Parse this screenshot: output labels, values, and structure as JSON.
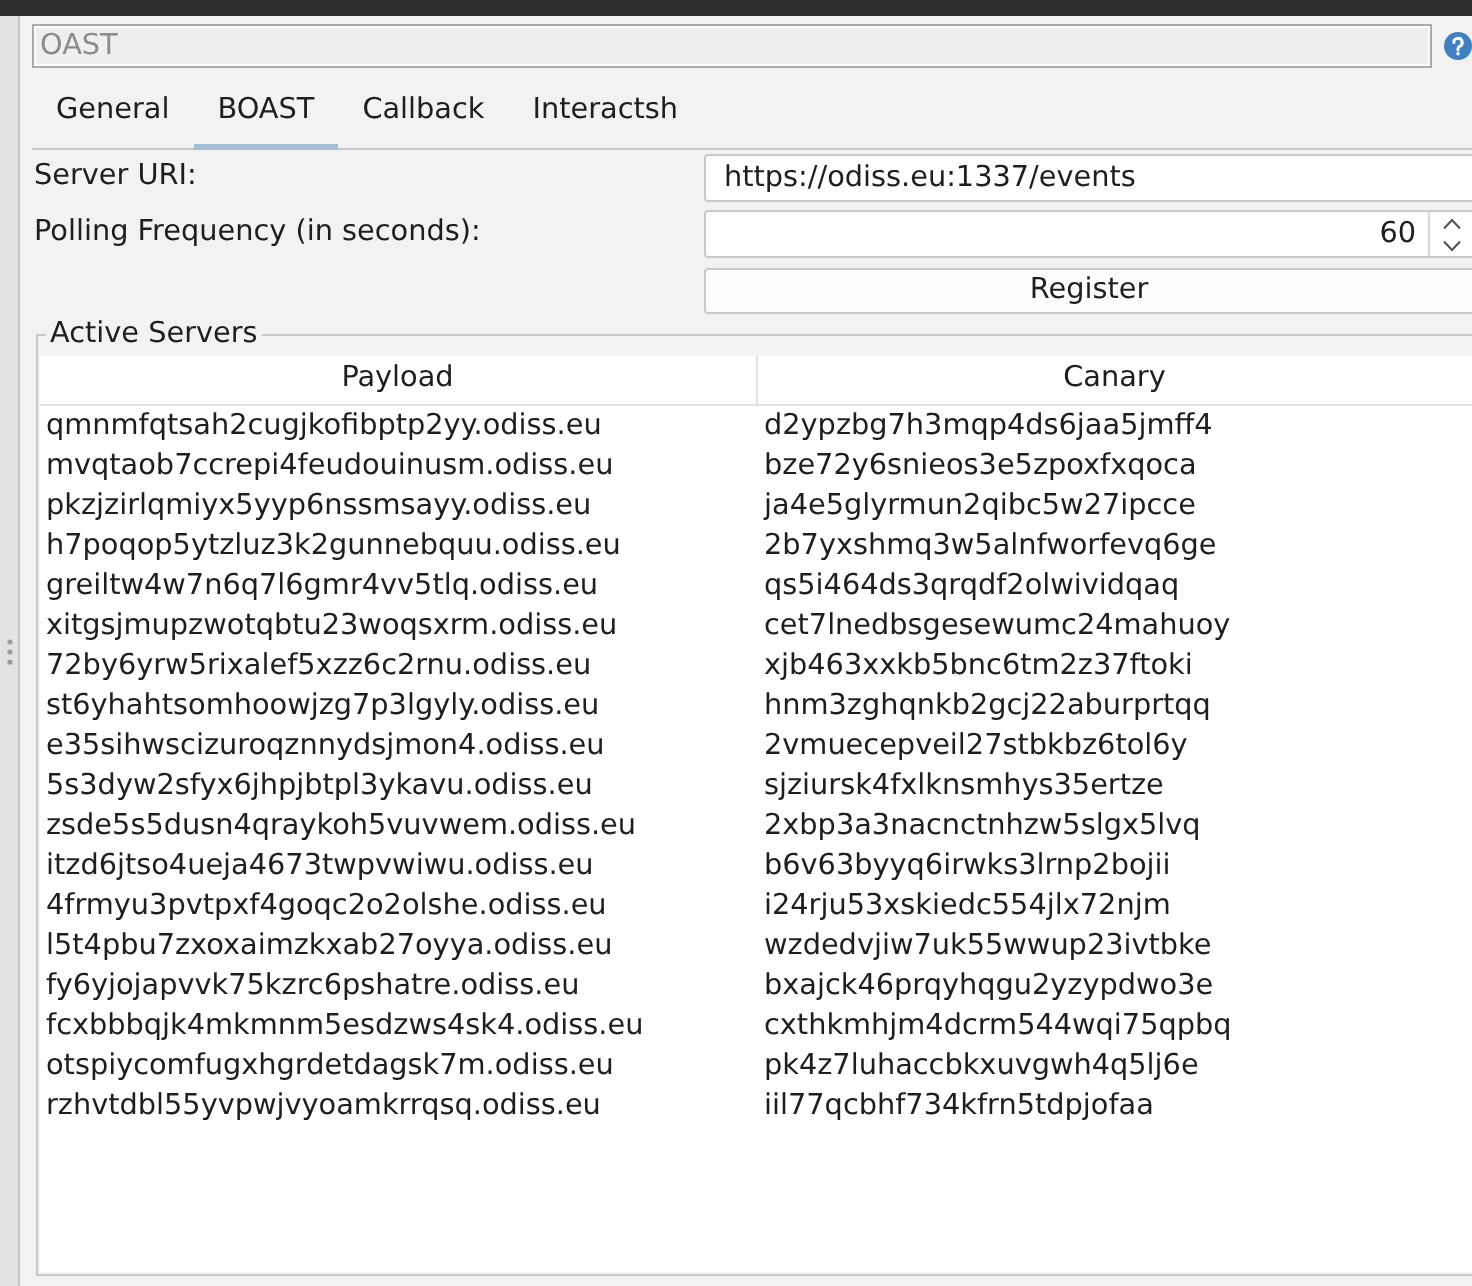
{
  "title_field": {
    "value": "OAST",
    "disabled": true
  },
  "tabs": [
    {
      "label": "General",
      "selected": false
    },
    {
      "label": "BOAST",
      "selected": true
    },
    {
      "label": "Callback",
      "selected": false
    },
    {
      "label": "Interactsh",
      "selected": false
    }
  ],
  "form": {
    "fields": [
      {
        "kind": "text",
        "label": "Server URI:",
        "value": "https://odiss.eu:1337/events"
      },
      {
        "kind": "spinner",
        "label": "Polling Frequency (in seconds):",
        "value": "60"
      }
    ],
    "button": "Register"
  },
  "active_servers": {
    "title": "Active Servers",
    "columns": [
      "Payload",
      "Canary"
    ],
    "rows": [
      [
        "qmnmfqtsah2cugjkofibptp2yy.odiss.eu",
        "d2ypzbg7h3mqp4ds6jaa5jmff4"
      ],
      [
        "mvqtaob7ccrepi4feudouinusm.odiss.eu",
        "bze72y6snieos3e5zpoxfxqoca"
      ],
      [
        "pkzjzirlqmiyx5yyp6nssmsayy.odiss.eu",
        "ja4e5glyrmun2qibc5w27ipcce"
      ],
      [
        "h7poqop5ytzluz3k2gunnebquu.odiss.eu",
        "2b7yxshmq3w5alnfworfevq6ge"
      ],
      [
        "greiltw4w7n6q7l6gmr4vv5tlq.odiss.eu",
        "qs5i464ds3qrqdf2olwividqaq"
      ],
      [
        "xitgsjmupzwotqbtu23woqsxrm.odiss.eu",
        "cet7lnedbsgesewumc24mahuoy"
      ],
      [
        "72by6yrw5rixalef5xzz6c2rnu.odiss.eu",
        "xjb463xxkb5bnc6tm2z37ftoki"
      ],
      [
        "st6yhahtsomhoowjzg7p3lgyly.odiss.eu",
        "hnm3zghqnkb2gcj22aburprtqq"
      ],
      [
        "e35sihwscizuroqznnydsjmon4.odiss.eu",
        "2vmuecepveil27stbkbz6tol6y"
      ],
      [
        "5s3dyw2sfyx6jhpjbtpl3ykavu.odiss.eu",
        "sjziursk4fxlknsmhys35ertze"
      ],
      [
        "zsde5s5dusn4qraykoh5vuvwem.odiss.eu",
        "2xbp3a3nacnctnhzw5slgx5lvq"
      ],
      [
        "itzd6jtso4ueja4673twpvwiwu.odiss.eu",
        "b6v63byyq6irwks3lrnp2bojii"
      ],
      [
        "4frmyu3pvtpxf4goqc2o2olshe.odiss.eu",
        "i24rju53xskiedc554jlx72njm"
      ],
      [
        "l5t4pbu7zxoxaimzkxab27oyya.odiss.eu",
        "wzdedvjiw7uk55wwup23ivtbke"
      ],
      [
        "fy6yjojapvvk75kzrc6pshatre.odiss.eu",
        "bxajck46prqyhqgu2yzypdwo3e"
      ],
      [
        "fcxbbbqjk4mkmnm5esdzws4sk4.odiss.eu",
        "cxthkmhjm4dcrm544wqi75qpbq"
      ],
      [
        "otspiycomfugxhgrdetdagsk7m.odiss.eu",
        "pk4z7luhaccbkxuvgwh4q5lj6e"
      ],
      [
        "rzhvtdbl55yvpwjvyoamkrrqsq.odiss.eu",
        "iil77qcbhf734kfrn5tdpjofaa"
      ]
    ]
  }
}
